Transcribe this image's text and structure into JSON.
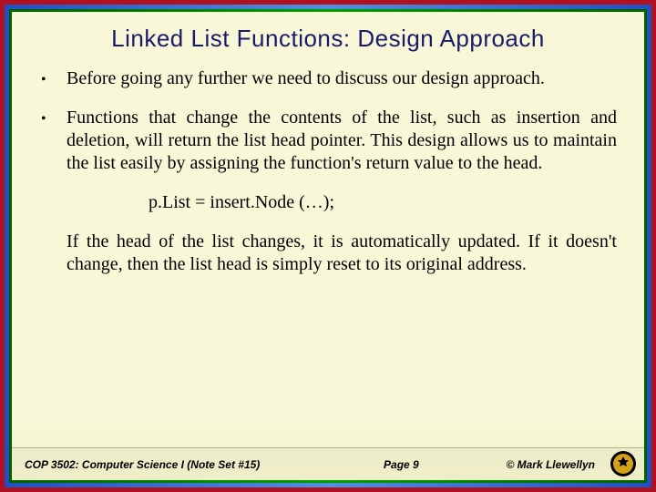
{
  "title": "Linked List Functions: Design Approach",
  "bullets": [
    {
      "marker": "•",
      "text": "Before going any further we need to discuss our design approach."
    },
    {
      "marker": "•",
      "text": "Functions that change the contents of the list, such as insertion and deletion, will return the list head pointer. This design allows us to maintain the list easily by assigning the function's return value to the head."
    }
  ],
  "code": "p.List = insert.Node (…);",
  "after": "If the head of the list changes, it is automatically updated.  If it doesn't change, then the list head is simply reset to its original address.",
  "footer": {
    "left": "COP 3502: Computer Science I (Note Set #15)",
    "center": "Page 9",
    "right": "© Mark Llewellyn"
  }
}
